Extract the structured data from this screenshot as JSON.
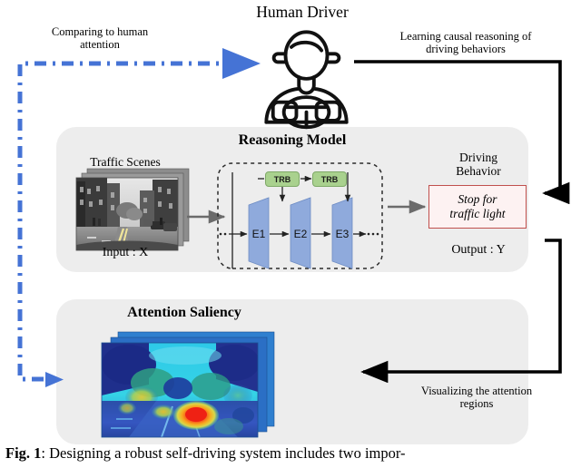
{
  "figure": {
    "caption_label": "Fig. 1",
    "caption_text": ": Designing a robust self-driving system includes two impor-"
  },
  "titles": {
    "human_driver": "Human Driver",
    "reasoning_model": "Reasoning Model",
    "attention_saliency": "Attention Saliency"
  },
  "edges": {
    "comparing": "Comparing to human\nattention",
    "learning": "Learning causal reasoning of\ndriving behaviors",
    "visualizing": "Visualizing the attention\nregions"
  },
  "model_panel": {
    "input_caption": "Traffic Scenes",
    "input_label": "Input : X",
    "output_caption": "Driving\nBehavior",
    "output_label": "Output : Y",
    "behavior_value": "Stop for\ntraffic light",
    "encoders": [
      "E1",
      "E2",
      "E3"
    ],
    "trb_blocks": [
      "TRB",
      "TRB"
    ],
    "ellipsis_left": "...",
    "ellipsis_right": "..."
  },
  "colors": {
    "panel_background": "#ededed",
    "dashed_flow_blue": "#4573d5",
    "encoder_blue": "#8faadc",
    "trb_green": "#a9d18e",
    "behavior_border_red": "#c0504d",
    "behavior_fill": "#fdf2f2",
    "solid_arrow_black": "#000000",
    "inner_arrow_gray": "#6b6b6b"
  }
}
